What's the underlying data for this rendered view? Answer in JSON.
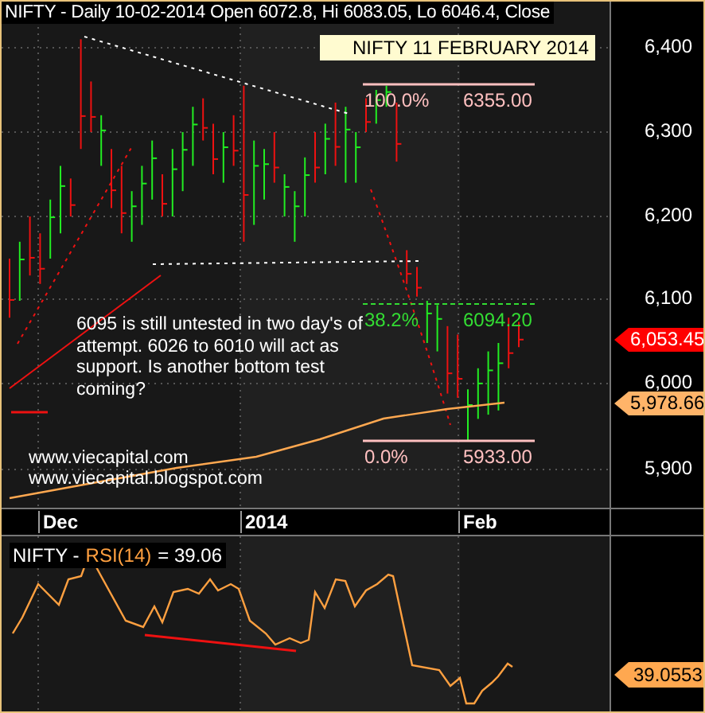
{
  "header": {
    "text": "NIFTY - Daily 10-02-2014 Open 6072.8, Hi 6083.05, Lo 6046.4, Close"
  },
  "price_panel": {
    "date_label": "NIFTY 11 FEBRUARY 2014",
    "fib_levels": [
      {
        "percent": "100.0%",
        "price": "6355.00",
        "kind": "solid",
        "color": "#ffc0c0"
      },
      {
        "percent": "38.2%",
        "price": "6094.20",
        "kind": "dashed",
        "color": "#33dd33"
      },
      {
        "percent": "0.0%",
        "price": "5933.00",
        "kind": "solid",
        "color": "#ffc0c0"
      }
    ],
    "note": "6095 is still untested in two day's of attempt. 6026 to 6010 will act as support. Is another bottom test coming?",
    "links": [
      "www.viecapital.com",
      "www.viecapital.blogspot.com"
    ]
  },
  "price_axis": {
    "ticks": [
      "6,400",
      "6,300",
      "6,200",
      "6,100",
      "6,000",
      "5,900"
    ],
    "tags": [
      {
        "text": "6,053.45",
        "kind": "last_price",
        "color": "#ff0000"
      },
      {
        "text": "5,978.66",
        "kind": "average",
        "color": "#ffb469"
      }
    ]
  },
  "time_axis": {
    "labels": [
      "Dec",
      "2014",
      "Feb"
    ]
  },
  "rsi_panel": {
    "symbol": "NIFTY -",
    "indicator": "RSI(14)",
    "value": "= 39.06",
    "tag": "39.0553"
  }
}
